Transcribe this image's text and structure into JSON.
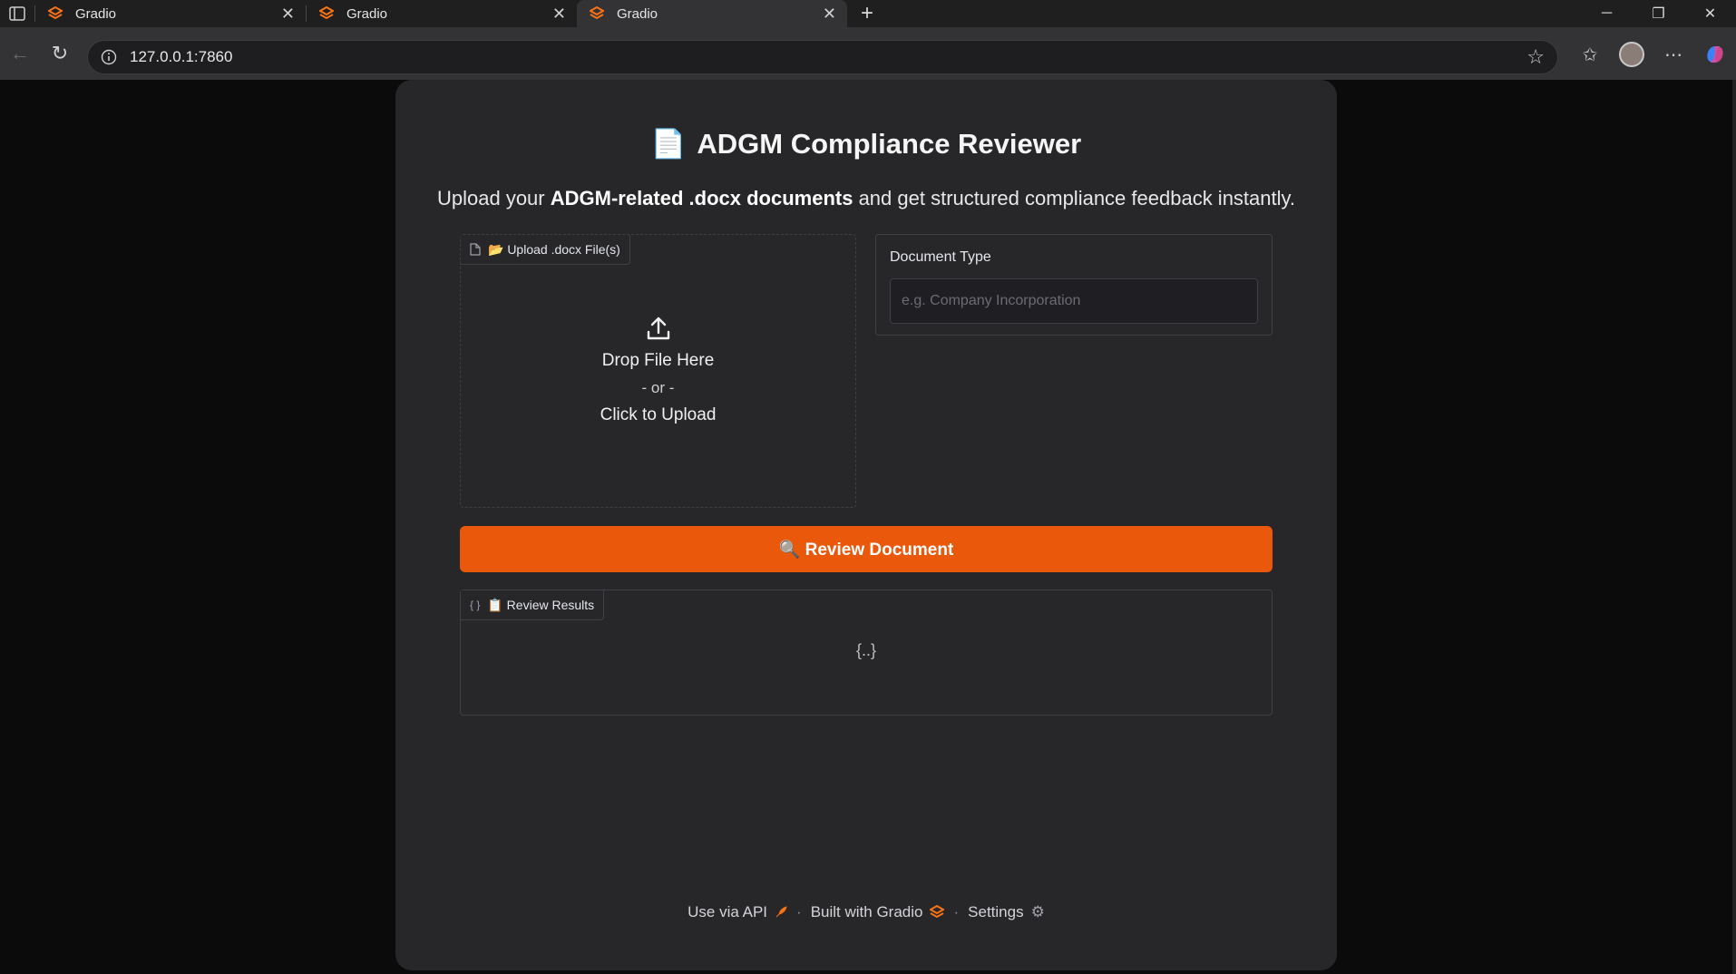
{
  "browser": {
    "tabs": [
      {
        "title": "Gradio",
        "active": false
      },
      {
        "title": "Gradio",
        "active": false
      },
      {
        "title": "Gradio",
        "active": true
      }
    ],
    "url": "127.0.0.1:7860"
  },
  "app": {
    "title_emoji": "📄",
    "title": "ADGM Compliance Reviewer",
    "subtitle_pre": "Upload your ",
    "subtitle_bold": "ADGM-related .docx documents",
    "subtitle_post": " and get structured compliance feedback instantly."
  },
  "upload": {
    "label": "📂 Upload .docx File(s)",
    "drop_text": "Drop File Here",
    "or_text": "- or -",
    "click_text": "Click to Upload"
  },
  "doc_type": {
    "label": "Document Type",
    "placeholder": "e.g. Company Incorporation",
    "value": ""
  },
  "review_button": {
    "label": "🔍 Review Document"
  },
  "results": {
    "label": "📋 Review Results",
    "empty_icon": "{..}"
  },
  "footer": {
    "api": "Use via API",
    "built": "Built with Gradio",
    "settings": "Settings",
    "separator": "·"
  },
  "colors": {
    "accent": "#ea580c",
    "panel": "#27272a",
    "background": "#0b0b0c"
  }
}
